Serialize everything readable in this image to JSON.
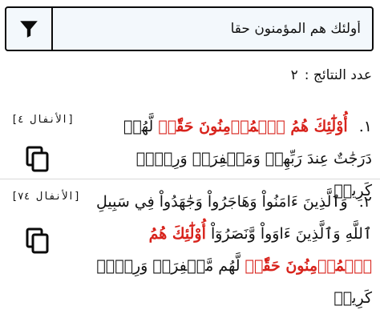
{
  "search": {
    "value": "أولئك هم المؤمنون حقا",
    "filter_icon": "filter-funnel-icon"
  },
  "results_count": {
    "label": "عدد النتائج :",
    "value": "٢"
  },
  "results": [
    {
      "number": "١.",
      "highlight": "أُوْلَٰٓئِكَ هُمُ ٱلۡمُؤۡمِنُونَ حَقّٗاۚ",
      "text_after": "لَّهُمۡ دَرَجَٰتٌ عِندَ رَبِّهِمۡ وَمَغۡفِرَةٞ وَرِزۡقٞ كَرِيمٞ",
      "reference": "[الأنفال ٤]",
      "copy_icon": "copy-icon"
    },
    {
      "number": "٢.",
      "text_before": "وَٱلَّذِينَ ءَامَنُواْ وَهَاجَرُواْ وَجَٰهَدُواْ فِي سَبِيلِ ٱللَّهِ وَٱلَّذِينَ ءَاوَواْ وَّنَصَرُوٓاْ",
      "highlight": "أُوْلَٰٓئِكَ هُمُ ٱلۡمُؤۡمِنُونَ حَقّٗاۚ",
      "text_after": "لَّهُم مَّغۡفِرَةٞ وَرِزۡقٞ كَرِيمٞ",
      "reference": "[الأنفال ٧٤]",
      "copy_icon": "copy-icon"
    }
  ]
}
